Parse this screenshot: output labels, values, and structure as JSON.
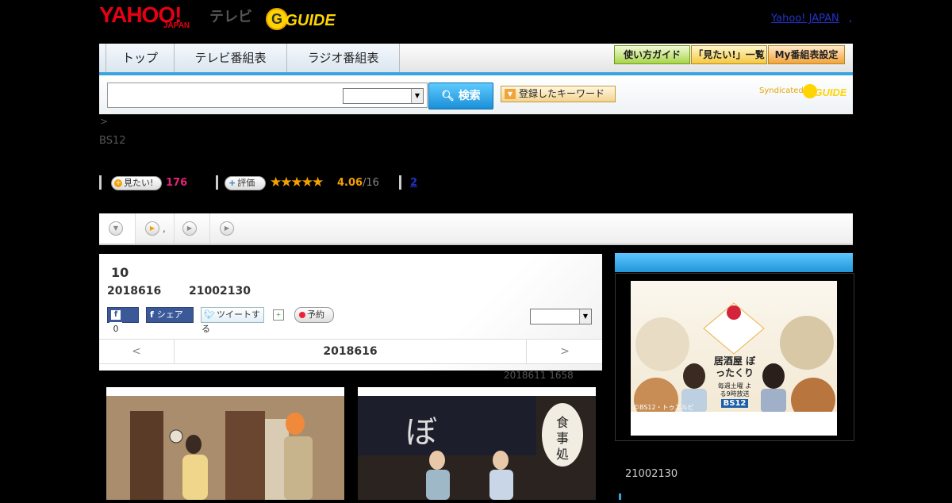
{
  "header": {
    "logo_yahoo": "YAHOO!",
    "logo_japan": "JAPAN",
    "logo_tv": "テレビ",
    "logo_gguide": "G GUIDE",
    "yahoo_japan_link": "Yahoo! JAPAN",
    "yahoo_japan_sep": ","
  },
  "nav": {
    "tabs": [
      "トップ",
      "テレビ番組表",
      "ラジオ番組表"
    ],
    "buttons": [
      "使い方ガイド",
      "「見たい!」一覧",
      "My番組表設定"
    ]
  },
  "search": {
    "button_label": "検索",
    "keyword_button_label": "登録したキーワード",
    "syndicated": "Syndicated"
  },
  "breadcrumb": ">",
  "station": "BS12",
  "stats": {
    "want_label": "見たい!",
    "want_count": "176",
    "rate_label": "評価",
    "stars": "★★★★★",
    "rating": "4.06",
    "rating_count": "/16",
    "review_count": "2"
  },
  "program": {
    "title": "10",
    "date": "2018616",
    "time": "21002130",
    "fb_count": "0",
    "share_label": "シェア",
    "tweet_label": "ツイートする",
    "reserve_label": "予約"
  },
  "day_nav": {
    "prev": "<",
    "current": "2018616",
    "next": ">"
  },
  "updated": "2018611  1658",
  "right_column": {
    "banner_title": "居酒屋 ぼったくり",
    "banner_sub": "毎週土曜 よる9時放送",
    "banner_station": "BS12",
    "banner_credit": "©BS12・トゥエルビ",
    "time": "21002130"
  },
  "colors": {
    "accent_blue": "#3aa4e0",
    "yahoo_red": "#e60012",
    "want_pink": "#e6227a",
    "star_orange": "#f3a000"
  }
}
